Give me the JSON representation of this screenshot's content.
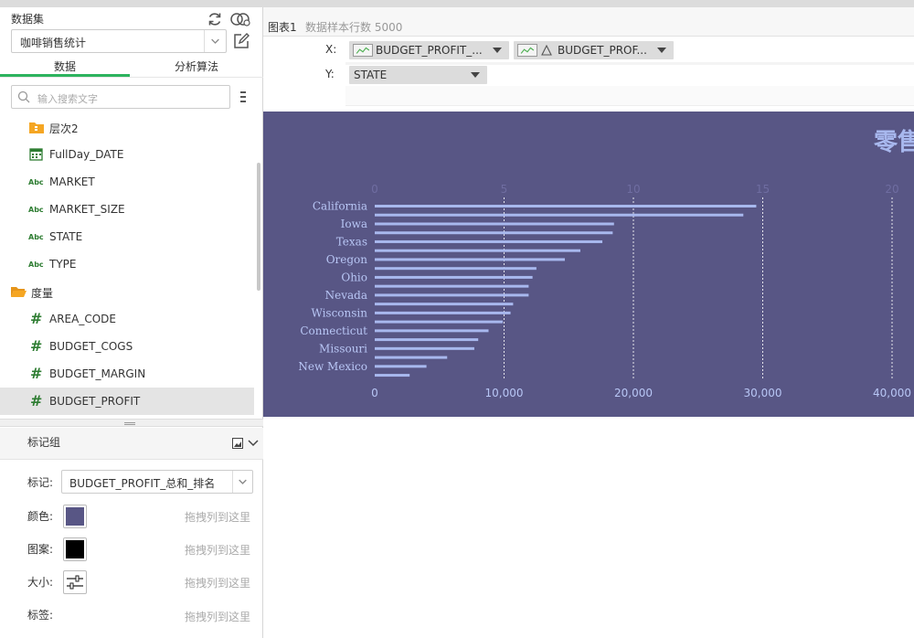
{
  "left": {
    "dataset_title": "数据集",
    "dataset_value": "咖啡销售统计",
    "tabs": {
      "data": "数据",
      "algorithms": "分析算法"
    },
    "search_placeholder": "输入搜索文字",
    "tree": [
      {
        "label": "层次2",
        "kind": "hierarchy"
      },
      {
        "label": "FullDay_DATE",
        "kind": "date"
      },
      {
        "label": "MARKET",
        "kind": "abc"
      },
      {
        "label": "MARKET_SIZE",
        "kind": "abc"
      },
      {
        "label": "STATE",
        "kind": "abc"
      },
      {
        "label": "TYPE",
        "kind": "abc"
      },
      {
        "label": "度量",
        "kind": "folder"
      },
      {
        "label": "AREA_CODE",
        "kind": "number"
      },
      {
        "label": "BUDGET_COGS",
        "kind": "number"
      },
      {
        "label": "BUDGET_MARGIN",
        "kind": "number"
      },
      {
        "label": "BUDGET_PROFIT",
        "kind": "number",
        "selected": true
      }
    ],
    "abc_glyph": "Abc",
    "hash_glyph": "#",
    "marks": {
      "title": "标记组",
      "mark_label": "标记:",
      "mark_value": "BUDGET_PROFIT_总和_排名",
      "color_label": "颜色:",
      "pattern_label": "图案:",
      "size_label": "大小:",
      "tag_label": "标签:",
      "drop_hint": "拖拽列到这里",
      "color_swatch": "#585685",
      "pattern_swatch": "#000000"
    }
  },
  "main": {
    "chart_name": "图表1",
    "rows_info": "数据样本行数 5000",
    "x_label": "X:",
    "y_label": "Y:",
    "x_pills": [
      "BUDGET_PROFIT_...",
      "BUDGET_PROF..."
    ],
    "y_pill": "STATE",
    "background": "#585685",
    "bar_color": "#a8b8ee"
  },
  "chart_data": {
    "type": "bar",
    "orientation": "horizontal",
    "title": "零售",
    "top_axis": {
      "ticks": [
        "0",
        "5",
        "10",
        "15",
        "20"
      ],
      "range": [
        0,
        22
      ]
    },
    "bottom_axis": {
      "ticks": [
        "0",
        "10,000",
        "20,000",
        "30,000",
        "40,000"
      ],
      "range": [
        0,
        44000
      ]
    },
    "y_tick_labels": [
      "California",
      "Iowa",
      "Texas",
      "Oregon",
      "Ohio",
      "Nevada",
      "Wisconsin",
      "Connecticut",
      "Missouri",
      "New Mexico"
    ],
    "series": [
      {
        "values": [
          29500,
          28500,
          18500,
          18400,
          17600,
          15900,
          14700,
          12500,
          12200,
          11900,
          11900,
          10700,
          10500,
          9900,
          8800,
          8000,
          7700,
          5600,
          4000,
          2700
        ]
      }
    ],
    "grid": true
  }
}
